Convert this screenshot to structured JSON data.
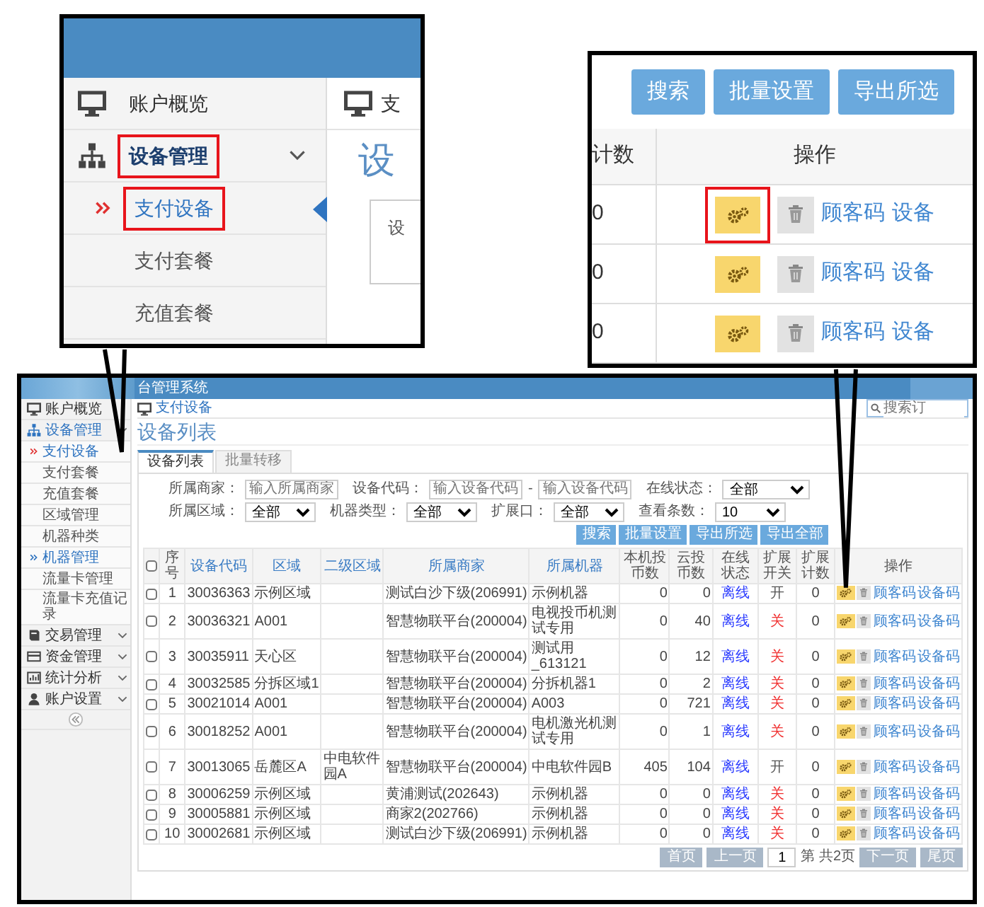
{
  "zoom_left": {
    "items": [
      {
        "label": "账户概览",
        "kind": "link",
        "highlighted": false,
        "expanded": false
      },
      {
        "label": "设备管理",
        "kind": "menu",
        "highlighted": true,
        "expanded": true,
        "children": [
          {
            "label": "支付设备",
            "selected": true,
            "highlighted": true
          },
          {
            "label": "支付套餐",
            "selected": false,
            "highlighted": false
          },
          {
            "label": "充值套餐",
            "selected": false,
            "highlighted": false
          }
        ]
      }
    ],
    "breadcrumb": "支",
    "title": "设",
    "tab": "设"
  },
  "zoom_right": {
    "buttons": [
      "搜索",
      "批量设置",
      "导出所选"
    ],
    "columns": [
      "计数",
      "操作"
    ],
    "rows": [
      {
        "count": "0",
        "highlighted": true,
        "links": [
          "顾客码",
          "设备"
        ]
      },
      {
        "count": "0",
        "highlighted": false,
        "links": [
          "顾客码",
          "设备"
        ]
      },
      {
        "count": "0",
        "highlighted": false,
        "links": [
          "顾客码",
          "设备"
        ]
      }
    ]
  },
  "app": {
    "title": "台管理系统",
    "search_placeholder": "搜索订",
    "sidebar": [
      {
        "label": "账户概览",
        "kind": "link",
        "expanded": false
      },
      {
        "label": "设备管理",
        "kind": "menu",
        "expanded": true,
        "children": [
          {
            "label": "支付设备",
            "kind": "link",
            "selected": true
          },
          {
            "label": "支付套餐",
            "kind": "link",
            "selected": false
          },
          {
            "label": "充值套餐",
            "kind": "link",
            "selected": false
          },
          {
            "label": "区域管理",
            "kind": "link",
            "selected": false
          },
          {
            "label": "机器种类",
            "kind": "link",
            "selected": false
          },
          {
            "label": "机器管理",
            "kind": "group",
            "selected": false
          },
          {
            "label": "流量卡管理",
            "kind": "link",
            "selected": false
          },
          {
            "label": "流量卡充值记录",
            "kind": "link",
            "selected": false
          }
        ]
      },
      {
        "label": "交易管理",
        "kind": "menu",
        "expanded": false
      },
      {
        "label": "资金管理",
        "kind": "menu",
        "expanded": false
      },
      {
        "label": "统计分析",
        "kind": "menu",
        "expanded": false
      },
      {
        "label": "账户设置",
        "kind": "menu",
        "expanded": false
      }
    ],
    "breadcrumb": "支付设备",
    "page_title": "设备列表",
    "tabs": [
      {
        "label": "设备列表",
        "selected": true
      },
      {
        "label": "批量转移",
        "selected": false
      }
    ],
    "filter_rows": [
      [
        {
          "kind": "input",
          "label": "所属商家：",
          "placeholder": "输入所属商家"
        },
        {
          "kind": "range",
          "label": "设备代码：",
          "placeholder": "输入设备代码",
          "separator": "-",
          "placeholder_2": "输入设备代码"
        },
        {
          "kind": "select",
          "label": "在线状态：",
          "value": "全部"
        }
      ],
      [
        {
          "kind": "select",
          "label": "所属区域：",
          "value": "全部"
        },
        {
          "kind": "select",
          "label": "机器类型：",
          "value": "全部"
        },
        {
          "kind": "select",
          "label": "扩展口：",
          "value": "全部"
        },
        {
          "kind": "select",
          "label": "查看条数：",
          "value": "10"
        }
      ]
    ],
    "buttons": [
      "搜索",
      "批量设置",
      "导出所选",
      "导出全部"
    ],
    "table": {
      "select_all": {
        "checked": false
      },
      "columns": [
        {
          "label": "序号",
          "sortable": false
        },
        {
          "label": "设备代码",
          "sortable": true
        },
        {
          "label": "区域",
          "sortable": true
        },
        {
          "label": "二级区域",
          "sortable": true
        },
        {
          "label": "所属商家",
          "sortable": true
        },
        {
          "label": "所属机器",
          "sortable": true
        },
        {
          "label": "本机投币数",
          "sortable": false
        },
        {
          "label": "云投币数",
          "sortable": false
        },
        {
          "label": "在线状态",
          "sortable": false
        },
        {
          "label": "扩展开关",
          "sortable": false
        },
        {
          "label": "扩展计数",
          "sortable": false
        },
        {
          "label": "操作",
          "sortable": false
        }
      ],
      "rows": [
        {
          "checked": false,
          "no": "1",
          "code": "30036363",
          "area": "示例区域",
          "merchant": "测试白沙下级(206991)",
          "machine": "示例机器",
          "local_coins": "0",
          "cloud_coins": "0",
          "online": "离线",
          "ext": "开",
          "ext_on": true,
          "ext_count": "0",
          "actions": [
            "顾客码",
            "设备码"
          ]
        },
        {
          "checked": false,
          "no": "2",
          "code": "30036321",
          "area": "A001",
          "merchant": "智慧物联平台(200004)",
          "machine": "电视投币机测试专用",
          "local_coins": "0",
          "cloud_coins": "40",
          "online": "离线",
          "ext": "关",
          "ext_on": false,
          "ext_count": "0",
          "actions": [
            "顾客码",
            "设备码"
          ]
        },
        {
          "checked": false,
          "no": "3",
          "code": "30035911",
          "area": "天心区",
          "merchant": "智慧物联平台(200004)",
          "machine": "测试用_613121",
          "local_coins": "0",
          "cloud_coins": "12",
          "online": "离线",
          "ext": "关",
          "ext_on": false,
          "ext_count": "0",
          "actions": [
            "顾客码",
            "设备码"
          ]
        },
        {
          "checked": false,
          "no": "4",
          "code": "30032585",
          "area": "分拆区域1",
          "merchant": "智慧物联平台(200004)",
          "machine": "分拆机器1",
          "local_coins": "0",
          "cloud_coins": "2",
          "online": "离线",
          "ext": "关",
          "ext_on": false,
          "ext_count": "0",
          "actions": [
            "顾客码",
            "设备码"
          ]
        },
        {
          "checked": false,
          "no": "5",
          "code": "30021014",
          "area": "A001",
          "merchant": "智慧物联平台(200004)",
          "machine": "A003",
          "local_coins": "0",
          "cloud_coins": "721",
          "online": "离线",
          "ext": "关",
          "ext_on": false,
          "ext_count": "0",
          "actions": [
            "顾客码",
            "设备码"
          ]
        },
        {
          "checked": false,
          "no": "6",
          "code": "30018252",
          "area": "A001",
          "merchant": "智慧物联平台(200004)",
          "machine": "电机激光机测试专用",
          "local_coins": "0",
          "cloud_coins": "1",
          "online": "离线",
          "ext": "关",
          "ext_on": false,
          "ext_count": "0",
          "actions": [
            "顾客码",
            "设备码"
          ]
        },
        {
          "checked": false,
          "no": "7",
          "code": "30013065",
          "area": "岳麓区A",
          "sub_area": "中电软件园A",
          "merchant": "智慧物联平台(200004)",
          "machine": "中电软件园B",
          "local_coins": "405",
          "cloud_coins": "104",
          "online": "离线",
          "ext": "开",
          "ext_on": true,
          "ext_count": "0",
          "actions": [
            "顾客码",
            "设备码"
          ]
        },
        {
          "checked": false,
          "no": "8",
          "code": "30006259",
          "area": "示例区域",
          "merchant": "黄浦测试(202643)",
          "machine": "示例机器",
          "local_coins": "0",
          "cloud_coins": "0",
          "online": "离线",
          "ext": "关",
          "ext_on": false,
          "ext_count": "0",
          "actions": [
            "顾客码",
            "设备码"
          ]
        },
        {
          "checked": false,
          "no": "9",
          "code": "30005881",
          "area": "示例区域",
          "merchant": "商家2(202766)",
          "machine": "示例机器",
          "local_coins": "0",
          "cloud_coins": "0",
          "online": "离线",
          "ext": "关",
          "ext_on": false,
          "ext_count": "0",
          "actions": [
            "顾客码",
            "设备码"
          ]
        },
        {
          "checked": false,
          "no": "10",
          "code": "30002681",
          "area": "示例区域",
          "merchant": "测试白沙下级(206991)",
          "machine": "示例机器",
          "local_coins": "0",
          "cloud_coins": "0",
          "online": "离线",
          "ext": "关",
          "ext_on": false,
          "ext_count": "0",
          "actions": [
            "顾客码",
            "设备码"
          ]
        }
      ]
    },
    "pagination": {
      "first": "首页",
      "prev": "上一页",
      "page": "1",
      "page_label": "第",
      "total": "共2页",
      "next": "下一页",
      "last": "尾页"
    }
  }
}
